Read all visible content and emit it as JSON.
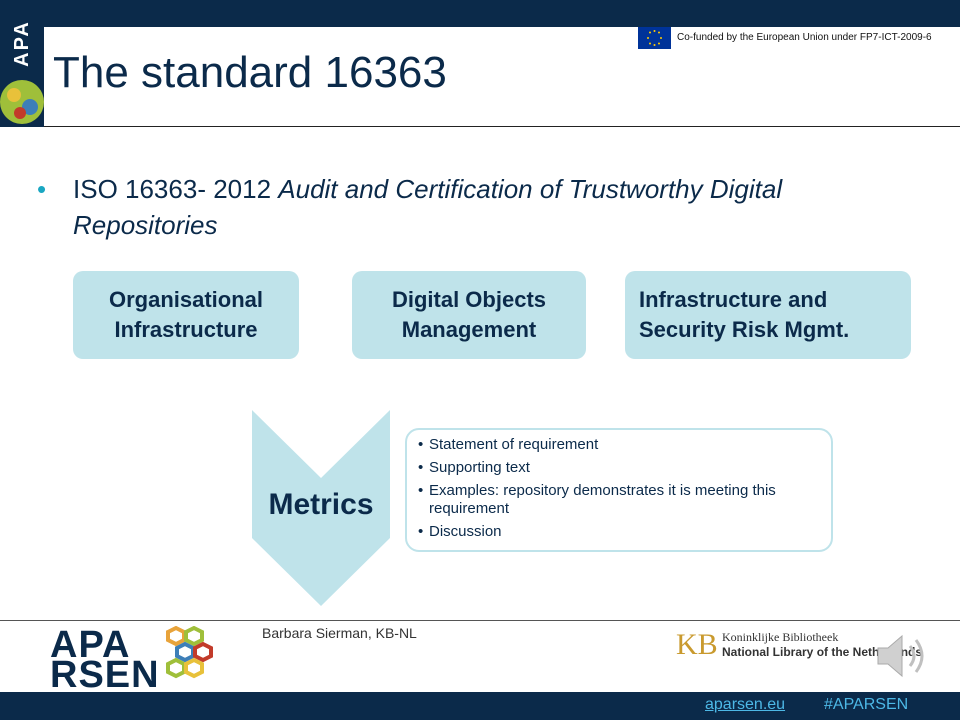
{
  "logo": {
    "text": "APA"
  },
  "header": {
    "title": "The standard 16363",
    "cofunding": "Co-funded by the European Union under FP7-ICT-2009-6"
  },
  "bullet": {
    "prefix": "ISO 16363- 2012 ",
    "italic": "Audit and Certification of Trustworthy Digital Repositories"
  },
  "boxes": [
    "Organisational\nInfrastructure",
    "Digital Objects\nManagement",
    "Infrastructure and\nSecurity Risk Mgmt."
  ],
  "metrics": {
    "label": "Metrics",
    "items": [
      "Statement of requirement",
      "Supporting text",
      "Examples: repository demonstrates it is meeting this requirement",
      "Discussion"
    ]
  },
  "footer": {
    "author": "Barbara Sierman, KB-NL",
    "aparsen_line1": "APA",
    "aparsen_line2": "RSEN",
    "kb_mark": "KB",
    "kb_line1": "Koninklijke Bibliotheek",
    "kb_line2": "National Library of the Netherlands",
    "link": "aparsen.eu",
    "hashtag": "#APARSEN"
  },
  "colors": {
    "navy": "#0b2a4a",
    "box": "#bfe3ea",
    "accent": "#1aa7c2",
    "link": "#4db8e6"
  },
  "icons": [
    "eu-flag-icon",
    "speaker-icon",
    "hexagon-cluster-icon"
  ]
}
